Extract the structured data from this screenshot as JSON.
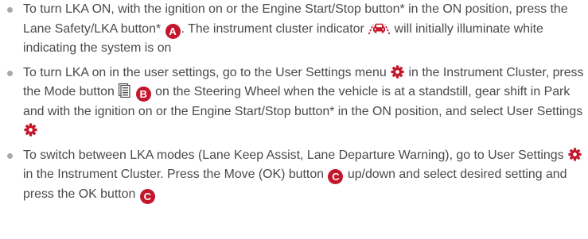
{
  "accent_color": "#c3172c",
  "text_color": "#4a4a4a",
  "bullet_color": "#a8a8a8",
  "items": [
    {
      "t1": "To turn LKA ON, with the ignition on or the Engine Start/Stop button* in the ON position, press the Lane Safety/LKA button*",
      "badge_a": "A",
      "t2": ". The instrument cluster indicator",
      "icon": "lka-car-indicator-icon",
      "t3": "will initially illuminate white indicating the system is on"
    },
    {
      "t1": "To turn LKA on in the user settings, go to the User Settings menu",
      "icon_gear_1": "gear-icon",
      "t2": "in the Instrument Cluster, press the Mode button",
      "icon_mode": "mode-button-icon",
      "badge_b": "B",
      "t3": "on the Steering Wheel when the vehicle is at a standstill, gear shift in Park and with the ignition on or the Engine Start/Stop button* in the ON position, and select User Settings",
      "icon_gear_2": "gear-icon"
    },
    {
      "t1": "To switch between LKA modes (Lane Keep Assist, Lane Departure Warning), go to User Settings",
      "icon_gear": "gear-icon",
      "t2": "in the Instrument Cluster. Press the Move (OK) button",
      "badge_c1": "C",
      "t3": "up/down and select desired setting and press the OK button",
      "badge_c2": "C"
    }
  ]
}
